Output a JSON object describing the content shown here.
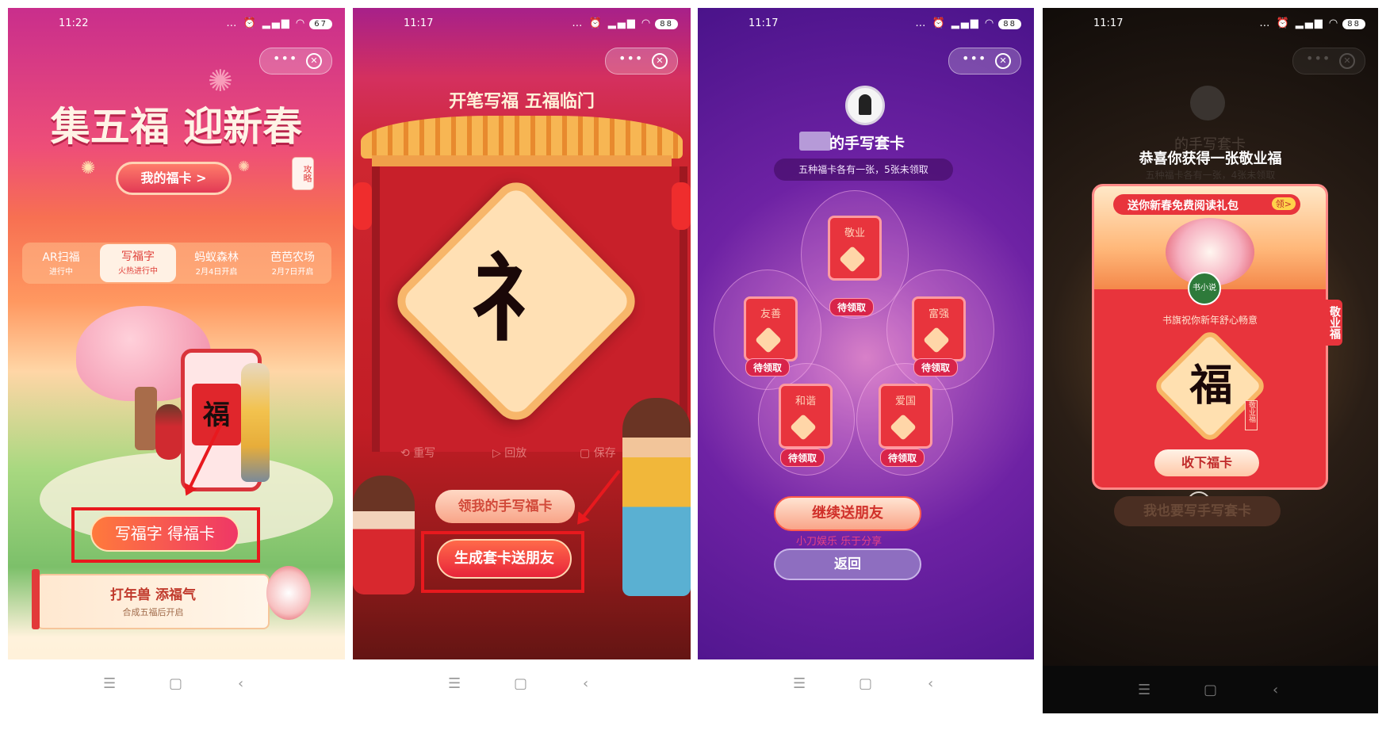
{
  "status": {
    "battery_1": "67",
    "battery_2": "88",
    "time_1": "11:22",
    "time_2": "11:17",
    "time_3": "11:17",
    "time_4": "11:17"
  },
  "capsule": {
    "more": "•••",
    "close": "✕"
  },
  "nav": {
    "menu": "☰",
    "home": "▢",
    "back": "‹"
  },
  "screen1": {
    "title": "集五福 迎新春",
    "my_cards_button": "我的福卡 >",
    "strategy_tag": "攻略",
    "tabs": [
      {
        "label": "AR扫福",
        "sub": "进行中"
      },
      {
        "label": "写福字",
        "sub": "火热进行中"
      },
      {
        "label": "蚂蚁森林",
        "sub": "2月4日开启"
      },
      {
        "label": "芭芭农场",
        "sub": "2月7日开启"
      }
    ],
    "phone_fu": "福",
    "write_button": "写福字 得福卡",
    "nian_title": "打年兽 添福气",
    "nian_sub": "合成五福后开启"
  },
  "screen2": {
    "banner": "开笔写福 五福临门",
    "brush_char": "礻",
    "tools": {
      "rewrite": "重写",
      "replay": "回放",
      "save": "保存"
    },
    "get_card_button": "领我的手写福卡",
    "send_button": "生成套卡送朋友"
  },
  "screen3": {
    "title": "的手写套卡",
    "subtitle": "五种福卡各有一张，5张未领取",
    "cards": [
      {
        "name": "敬业",
        "status": "待领取"
      },
      {
        "name": "友善",
        "status": "待领取"
      },
      {
        "name": "富强",
        "status": "待领取"
      },
      {
        "name": "和谐",
        "status": "待领取"
      },
      {
        "name": "爱国",
        "status": "待领取"
      }
    ],
    "card_fu": "福",
    "continue_button": "继续送朋友",
    "back_button": "返回",
    "watermark": "小刀娱乐 乐于分享"
  },
  "screen4": {
    "bg_title": "的手写套卡",
    "headline": "恭喜你获得一张敬业福",
    "bg_subtitle": "五种福卡各有一张，4张未领取",
    "gift_banner": "送你新春免费阅读礼包",
    "gift_badge": "领>",
    "book_badge": "书小说",
    "message": "书旗祝你新年舒心畅意",
    "side_label": "敬业福",
    "fu_char": "福",
    "stamp": "敬业福",
    "collect_button": "收下福卡",
    "bg_button": "我也要写手写套卡",
    "close": "✕"
  },
  "colors": {
    "red_highlight": "#e8191e",
    "screen1_top": "#e63a84",
    "screen2_bg": "#c91d24",
    "screen3_bg": "#6a1aa0",
    "screen4_bg": "#1a1410"
  }
}
